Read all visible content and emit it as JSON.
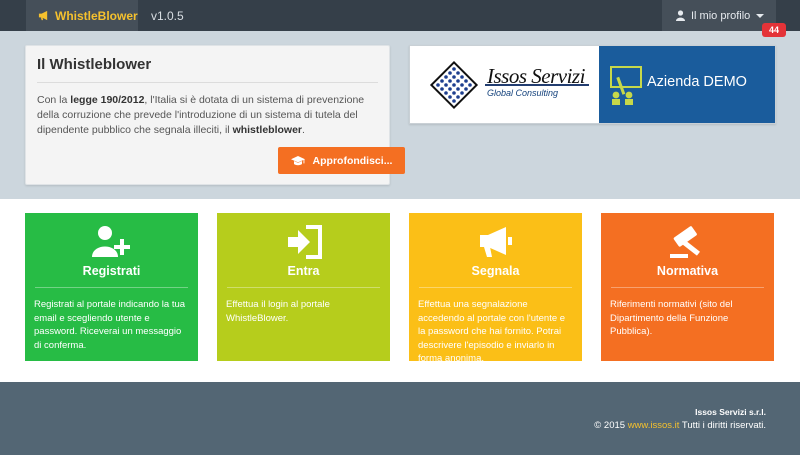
{
  "navbar": {
    "brand": "WhistleBlower",
    "version": "v1.0.5",
    "profile_label": "Il mio profilo",
    "notification_count": "44"
  },
  "info": {
    "title": "Il Whistleblower",
    "text_1": "Con la ",
    "law": "legge 190/2012",
    "text_2": ", l'Italia si è dotata di un sistema di prevenzione della corruzione che prevede l'introduzione di un sistema di tutela del dipendente pubblico che segnala illeciti, il ",
    "term": "whistleblower",
    "text_3": ".",
    "button_label": "Approfondisci..."
  },
  "banner": {
    "logo_main": "Issos Servizi",
    "logo_sub": "Global Consulting",
    "company": "Azienda DEMO"
  },
  "tiles": [
    {
      "title": "Registrati",
      "desc": "Registrati al portale indicando la tua email e scegliendo utente e password. Riceverai un messaggio di conferma.",
      "color": "#27bc45"
    },
    {
      "title": "Entra",
      "desc": "Effettua il login al portale WhistleBlower.",
      "color": "#b6cd1c"
    },
    {
      "title": "Segnala",
      "desc": "Effettua una segnalazione accedendo al portale con l'utente e la password che hai fornito. Potrai descrivere l'episodio e inviarlo in forma anonima.",
      "color": "#fbbf17"
    },
    {
      "title": "Normativa",
      "desc": "Riferimenti normativi (sito del Dipartimento della Funzione Pubblica).",
      "color": "#f46f22"
    }
  ],
  "footer": {
    "company": "Issos Servizi s.r.l.",
    "copyright": "© 2015",
    "link": "www.issos.it",
    "rights": "Tutti i diritti riservati."
  }
}
